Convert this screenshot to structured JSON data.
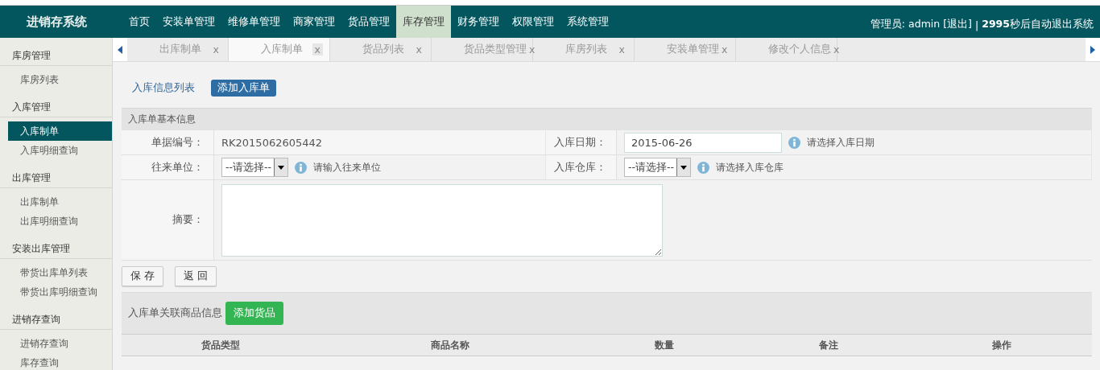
{
  "header": {
    "logo": "进销存系统",
    "nav": [
      {
        "label": "首页",
        "selected": false
      },
      {
        "label": "安装单管理",
        "selected": false
      },
      {
        "label": "维修单管理",
        "selected": false
      },
      {
        "label": "商家管理",
        "selected": false
      },
      {
        "label": "货品管理",
        "selected": false
      },
      {
        "label": "库存管理",
        "selected": true
      },
      {
        "label": "财务管理",
        "selected": false
      },
      {
        "label": "权限管理",
        "selected": false
      },
      {
        "label": "系统管理",
        "selected": false
      }
    ],
    "user_prefix": "管理员: admin",
    "logout": "[退出]",
    "separator": "|",
    "countdown": "2995",
    "countdown_suffix": "秒后自动退出系统"
  },
  "sidebar": [
    {
      "title": "库房管理",
      "items": [
        {
          "label": "库房列表",
          "selected": false
        }
      ]
    },
    {
      "title": "入库管理",
      "items": [
        {
          "label": "入库制单",
          "selected": true
        },
        {
          "label": "入库明细查询",
          "selected": false
        }
      ]
    },
    {
      "title": "出库管理",
      "items": [
        {
          "label": "出库制单",
          "selected": false
        },
        {
          "label": "出库明细查询",
          "selected": false
        }
      ]
    },
    {
      "title": "安装出库管理",
      "items": [
        {
          "label": "带货出库单列表",
          "selected": false
        },
        {
          "label": "带货出库明细查询",
          "selected": false
        }
      ]
    },
    {
      "title": "进销存查询",
      "items": [
        {
          "label": "进销存查询",
          "selected": false
        },
        {
          "label": "库存查询",
          "selected": false
        }
      ]
    }
  ],
  "tabs": [
    {
      "label": "出库制单",
      "close": "x",
      "selected": false
    },
    {
      "label": "入库制单",
      "close": "x",
      "selected": true
    },
    {
      "label": "货品列表",
      "close": "x",
      "selected": false
    },
    {
      "label": "货品类型管理",
      "close": "x",
      "selected": false
    },
    {
      "label": "库房列表",
      "close": "x",
      "selected": false
    },
    {
      "label": "安装单管理",
      "close": "x",
      "selected": false
    },
    {
      "label": "修改个人信息",
      "close": "x",
      "selected": false
    }
  ],
  "subnav": [
    {
      "label": "入库信息列表",
      "selected": false
    },
    {
      "label": "添加入库单",
      "selected": true
    }
  ],
  "form": {
    "title": "入库单基本信息",
    "doc_no_label": "单据编号：",
    "doc_no": "RK2015062605442",
    "date_label": "入库日期：",
    "date_value": "2015-06-26",
    "date_hint": "请选择入库日期",
    "partner_label": "往来单位：",
    "partner_value": "--请选择--",
    "partner_hint": "请输入往来单位",
    "warehouse_label": "入库仓库：",
    "warehouse_value": "--请选择--",
    "warehouse_hint": "请选择入库仓库",
    "summary_label": "摘要："
  },
  "buttons": [
    "保 存",
    "返 回"
  ],
  "goods": {
    "title": "入库单关联商品信息",
    "add_button": "添加货品",
    "columns": [
      "货品类型",
      "商品名称",
      "数量",
      "备注",
      "操作"
    ]
  }
}
